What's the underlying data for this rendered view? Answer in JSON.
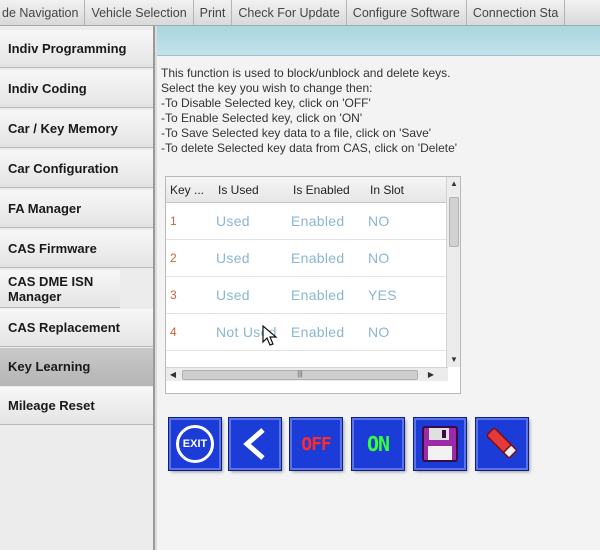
{
  "menubar": {
    "items": [
      "de Navigation",
      "Vehicle Selection",
      "Print",
      "Check For Update",
      "Configure Software",
      "Connection Sta"
    ]
  },
  "sidebar": {
    "items": [
      {
        "label": "Indiv Programming"
      },
      {
        "label": "Indiv Coding"
      },
      {
        "label": "Car / Key Memory"
      },
      {
        "label": "Car Configuration"
      },
      {
        "label": "FA Manager"
      },
      {
        "label": "CAS Firmware"
      },
      {
        "label": "CAS DME ISN Manager"
      },
      {
        "label": "CAS Replacement"
      },
      {
        "label": "Key Learning",
        "active": true
      },
      {
        "label": "Mileage Reset"
      }
    ]
  },
  "instructions": [
    "This function is used to block/unblock and delete keys.",
    "Select the key you wish to change then:",
    "-To Disable Selected key, click on 'OFF'",
    "-To Enable Selected key, click on 'ON'",
    "-To Save Selected key data to a file, click on 'Save'",
    "-To delete Selected key data from CAS, click on 'Delete'"
  ],
  "table": {
    "headers": [
      "Key ...",
      "Is Used",
      "Is Enabled",
      "In Slot"
    ],
    "rows": [
      [
        "1",
        "Used",
        "Enabled",
        "NO"
      ],
      [
        "2",
        "Used",
        "Enabled",
        "NO"
      ],
      [
        "3",
        "Used",
        "Enabled",
        "YES"
      ],
      [
        "4",
        "Not Used",
        "Enabled",
        "NO"
      ]
    ]
  },
  "buttons": {
    "exit_label": "EXIT",
    "off_label": "OFF",
    "on_label": "ON"
  },
  "colors": {
    "button_blue": "#1c3cd8",
    "off_red": "#ff2a2a",
    "on_green": "#35ff3a",
    "header_teal": "#a9d6df",
    "cell_text": "#8ab6d2",
    "key_text": "#c8643e"
  },
  "icons": {
    "back": "chevron-left-icon",
    "save": "floppy-disk-icon",
    "delete": "eraser-icon",
    "exit": "exit-icon"
  }
}
